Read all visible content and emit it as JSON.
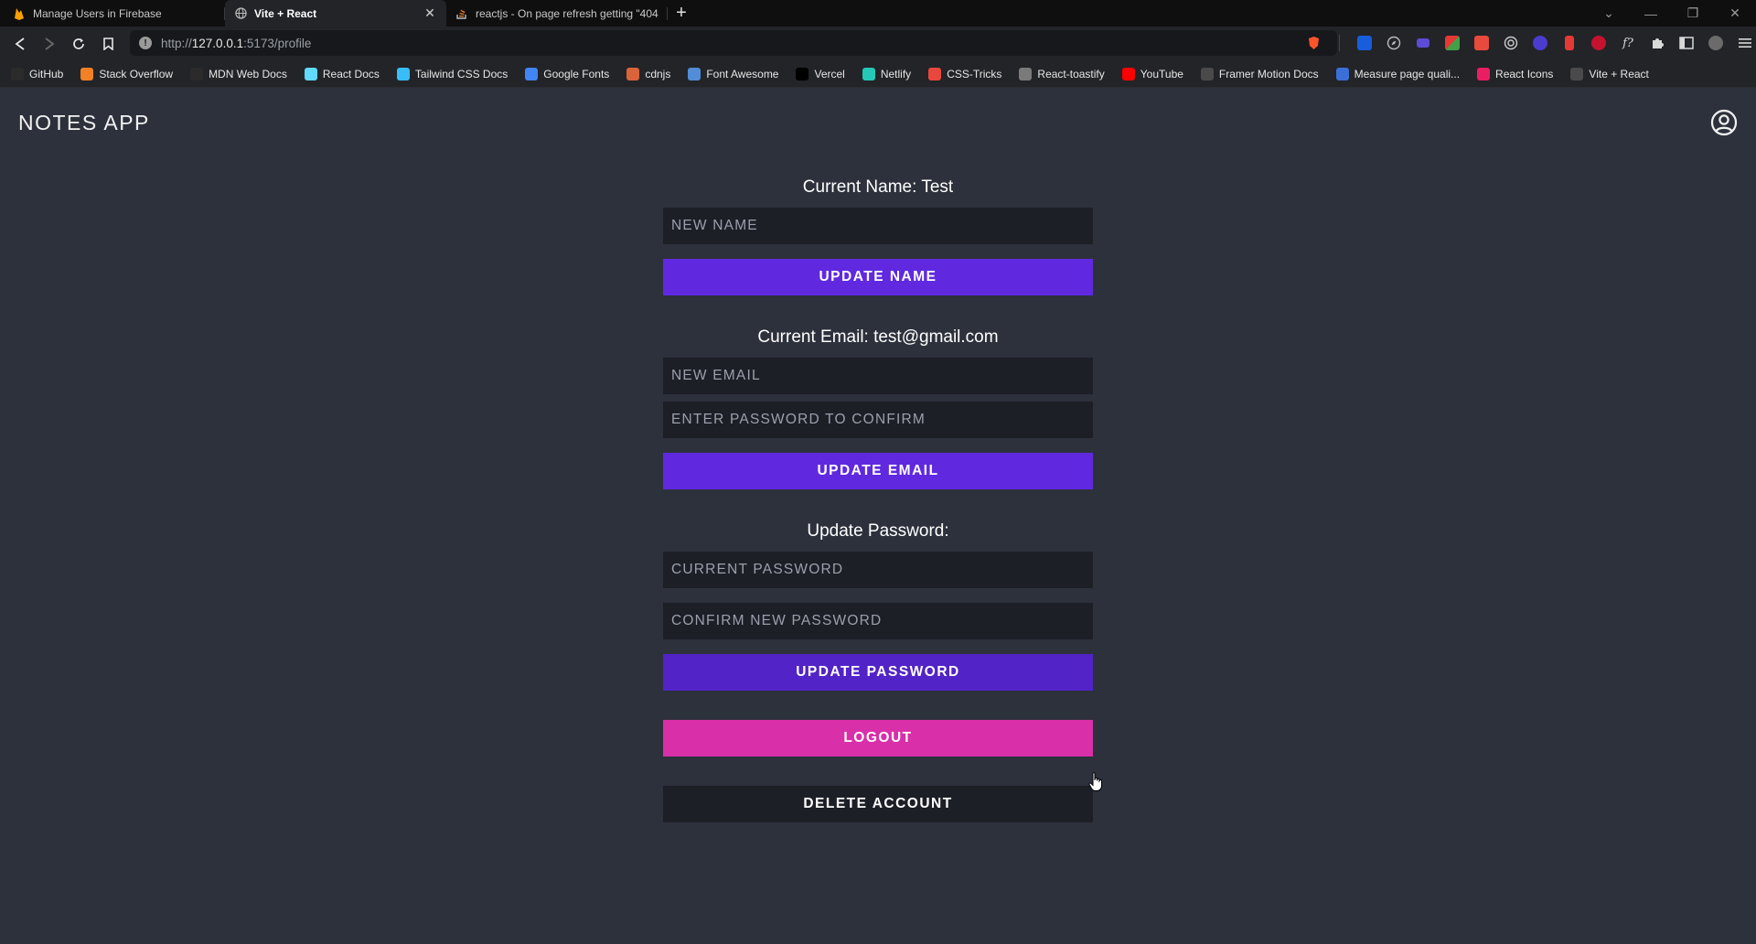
{
  "browser": {
    "tabs": [
      {
        "title": "Manage Users in Firebase",
        "active": false,
        "icon": "firebase-icon"
      },
      {
        "title": "Vite + React",
        "active": true,
        "icon": "globe-icon"
      },
      {
        "title": "reactjs - On page refresh getting \"404",
        "active": false,
        "icon": "stackoverflow-icon"
      }
    ],
    "new_tab_label": "+",
    "close_label": "✕",
    "url_prefix": "http://",
    "url_host": "127.0.0.1",
    "url_rest": ":5173/profile",
    "bookmarks": [
      {
        "label": "GitHub",
        "icon": "github-icon",
        "color": "#2b2b2b"
      },
      {
        "label": "Stack Overflow",
        "icon": "stackoverflow-icon",
        "color": "#f48024"
      },
      {
        "label": "MDN Web Docs",
        "icon": "mdn-icon",
        "color": "#2b2b2b"
      },
      {
        "label": "React Docs",
        "icon": "react-icon",
        "color": "#61dafb"
      },
      {
        "label": "Tailwind CSS Docs",
        "icon": "tailwind-icon",
        "color": "#38bdf8"
      },
      {
        "label": "Google Fonts",
        "icon": "google-fonts-icon",
        "color": "#4285f4"
      },
      {
        "label": "cdnjs",
        "icon": "cdnjs-icon",
        "color": "#d9643a"
      },
      {
        "label": "Font Awesome",
        "icon": "flag-icon",
        "color": "#528dd7"
      },
      {
        "label": "Vercel",
        "icon": "vercel-icon",
        "color": "#000000"
      },
      {
        "label": "Netlify",
        "icon": "netlify-icon",
        "color": "#25c7b7"
      },
      {
        "label": "CSS-Tricks",
        "icon": "css-tricks-icon",
        "color": "#e8473d"
      },
      {
        "label": "React-toastify",
        "icon": "toastify-icon",
        "color": "#7a7a7a"
      },
      {
        "label": "YouTube",
        "icon": "youtube-icon",
        "color": "#ff0000"
      },
      {
        "label": "Framer Motion Docs",
        "icon": "globe-icon",
        "color": "#4a4a4a"
      },
      {
        "label": "Measure page quali...",
        "icon": "lighthouse-icon",
        "color": "#3b6fd8"
      },
      {
        "label": "React Icons",
        "icon": "react-icons-icon",
        "color": "#e91e63"
      },
      {
        "label": "Vite + React",
        "icon": "globe-icon",
        "color": "#4a4a4a"
      }
    ]
  },
  "app": {
    "brand": "NOTES APP",
    "name_section": {
      "heading": "Current Name: Test",
      "new_name_placeholder": "NEW NAME",
      "button": "UPDATE NAME"
    },
    "email_section": {
      "heading": "Current Email: test@gmail.com",
      "new_email_placeholder": "NEW EMAIL",
      "confirm_password_placeholder": "ENTER PASSWORD TO CONFIRM",
      "button": "UPDATE EMAIL"
    },
    "password_section": {
      "heading": "Update Password:",
      "current_password_placeholder": "CURRENT PASSWORD",
      "new_password_placeholder": "CONFIRM NEW PASSWORD",
      "button": "UPDATE PASSWORD"
    },
    "logout_button": "LOGOUT",
    "delete_button": "DELETE ACCOUNT",
    "colors": {
      "background": "#2d313c",
      "input": "#1d1f27",
      "primary": "#6029e0",
      "logout": "#d92fa8"
    }
  }
}
